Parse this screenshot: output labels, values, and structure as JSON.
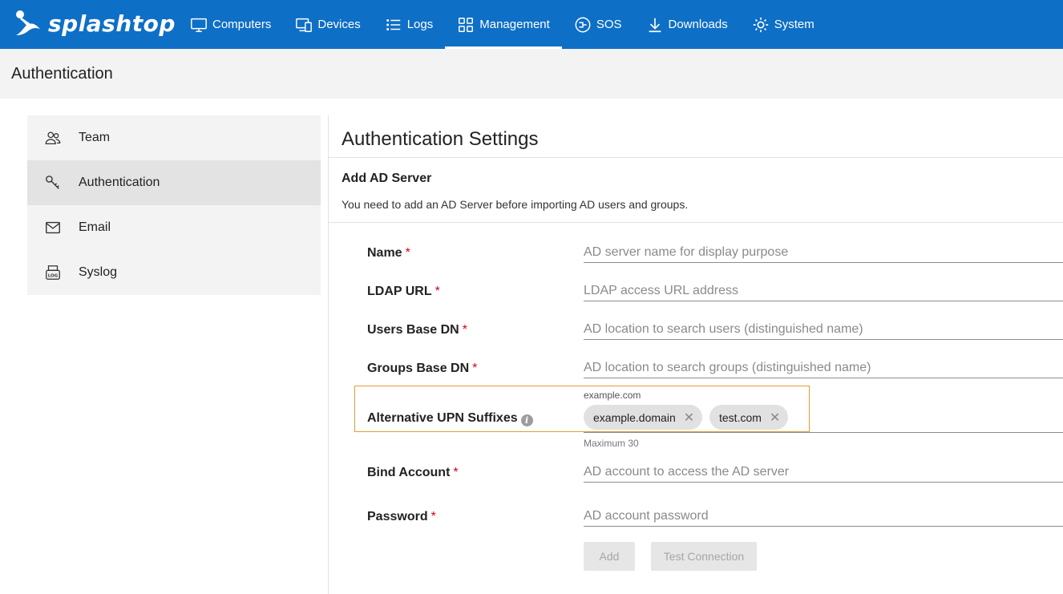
{
  "app": {
    "brand": "splashtop"
  },
  "nav": [
    {
      "label": "Computers",
      "icon": "monitor-icon"
    },
    {
      "label": "Devices",
      "icon": "devices-icon"
    },
    {
      "label": "Logs",
      "icon": "list-icon"
    },
    {
      "label": "Management",
      "icon": "grid-icon",
      "active": true
    },
    {
      "label": "SOS",
      "icon": "sos-icon"
    },
    {
      "label": "Downloads",
      "icon": "download-icon"
    },
    {
      "label": "System",
      "icon": "gear-icon"
    }
  ],
  "page": {
    "title": "Authentication"
  },
  "sidebar": {
    "items": [
      {
        "label": "Team",
        "icon": "team-icon"
      },
      {
        "label": "Authentication",
        "icon": "key-icon",
        "active": true
      },
      {
        "label": "Email",
        "icon": "mail-icon"
      },
      {
        "label": "Syslog",
        "icon": "log-icon"
      }
    ]
  },
  "main": {
    "title": "Authentication Settings",
    "subtitle": "Add AD Server",
    "description": "You need to add an AD Server before importing AD users and groups."
  },
  "form": {
    "required_mark": "*",
    "name": {
      "label": "Name",
      "placeholder": "AD server name for display purpose",
      "value": ""
    },
    "ldap_url": {
      "label": "LDAP URL",
      "placeholder": "LDAP access URL address",
      "value": ""
    },
    "users_base_dn": {
      "label": "Users Base DN",
      "placeholder": "AD location to search users (distinguished name)",
      "value": ""
    },
    "groups_base_dn": {
      "label": "Groups Base DN",
      "placeholder": "AD location to search groups (distinguished name)",
      "value": ""
    },
    "upn": {
      "label": "Alternative UPN Suffixes",
      "info": "i",
      "hint_top": "example.com",
      "chips": [
        "example.domain",
        "test.com"
      ],
      "hint_bottom": "Maximum 30"
    },
    "bind_account": {
      "label": "Bind Account",
      "placeholder": "AD account to access the AD server",
      "value": ""
    },
    "password": {
      "label": "Password",
      "placeholder": "AD account password",
      "value": ""
    }
  },
  "buttons": {
    "add": "Add",
    "test": "Test Connection"
  },
  "colors": {
    "nav_bg": "#0e6fc6",
    "required": "#d0021b",
    "focus_border": "#e39b38"
  }
}
